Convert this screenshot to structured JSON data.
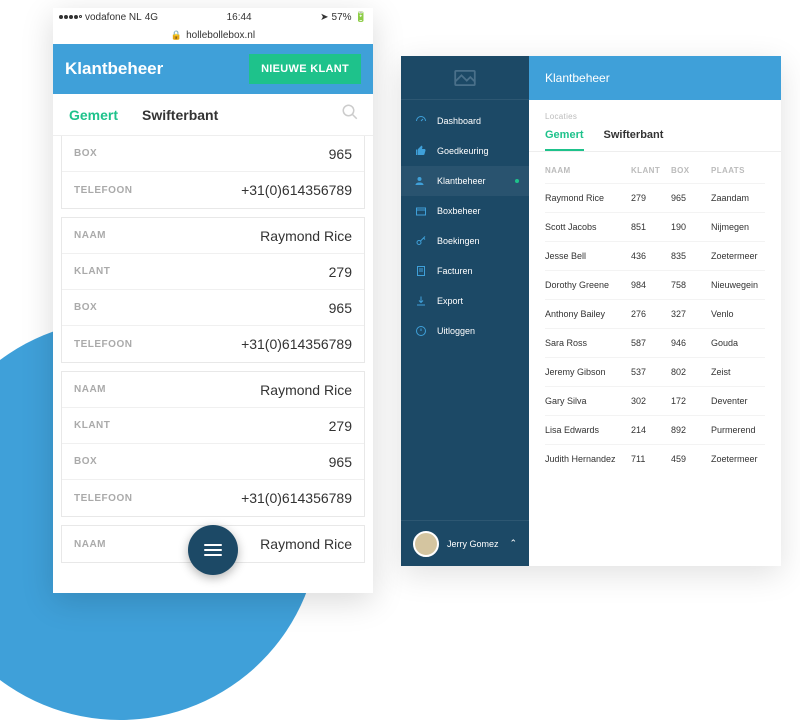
{
  "statusbar": {
    "carrier": "vodafone NL",
    "net": "4G",
    "time": "16:44",
    "battery": "57%"
  },
  "address": "hollebollebox.nl",
  "mobile": {
    "title": "Klantbeheer",
    "new_button": "NIEUWE KLANT",
    "tabs": [
      "Gemert",
      "Swifterbant"
    ],
    "labels": {
      "naam": "NAAM",
      "klant": "KLANT",
      "box": "BOX",
      "tel": "TELEFOON"
    },
    "partial_top": {
      "box": "965",
      "tel": "+31(0)614356789"
    },
    "cards": [
      {
        "naam": "Raymond Rice",
        "klant": "279",
        "box": "965",
        "tel": "+31(0)614356789"
      },
      {
        "naam": "Raymond Rice",
        "klant": "279",
        "box": "965",
        "tel": "+31(0)614356789"
      }
    ],
    "partial_bottom": {
      "naam": "Raymond Rice"
    }
  },
  "desktop": {
    "sidebar": {
      "items": [
        {
          "label": "Dashboard"
        },
        {
          "label": "Goedkeuring"
        },
        {
          "label": "Klantbeheer"
        },
        {
          "label": "Boxbeheer"
        },
        {
          "label": "Boekingen"
        },
        {
          "label": "Facturen"
        },
        {
          "label": "Export"
        },
        {
          "label": "Uitloggen"
        }
      ],
      "user": "Jerry Gomez"
    },
    "title": "Klantbeheer",
    "subtitle": "Locaties",
    "tabs": [
      "Gemert",
      "Swifterbant"
    ],
    "columns": {
      "naam": "NAAM",
      "klant": "KLANT",
      "box": "BOX",
      "plaats": "PLAATS"
    },
    "rows": [
      {
        "naam": "Raymond Rice",
        "klant": "279",
        "box": "965",
        "plaats": "Zaandam"
      },
      {
        "naam": "Scott Jacobs",
        "klant": "851",
        "box": "190",
        "plaats": "Nijmegen"
      },
      {
        "naam": "Jesse Bell",
        "klant": "436",
        "box": "835",
        "plaats": "Zoetermeer"
      },
      {
        "naam": "Dorothy Greene",
        "klant": "984",
        "box": "758",
        "plaats": "Nieuwegein"
      },
      {
        "naam": "Anthony Bailey",
        "klant": "276",
        "box": "327",
        "plaats": "Venlo"
      },
      {
        "naam": "Sara Ross",
        "klant": "587",
        "box": "946",
        "plaats": "Gouda"
      },
      {
        "naam": "Jeremy Gibson",
        "klant": "537",
        "box": "802",
        "plaats": "Zeist"
      },
      {
        "naam": "Gary Silva",
        "klant": "302",
        "box": "172",
        "plaats": "Deventer"
      },
      {
        "naam": "Lisa Edwards",
        "klant": "214",
        "box": "892",
        "plaats": "Purmerend"
      },
      {
        "naam": "Judith Hernandez",
        "klant": "711",
        "box": "459",
        "plaats": "Zoetermeer"
      }
    ]
  }
}
